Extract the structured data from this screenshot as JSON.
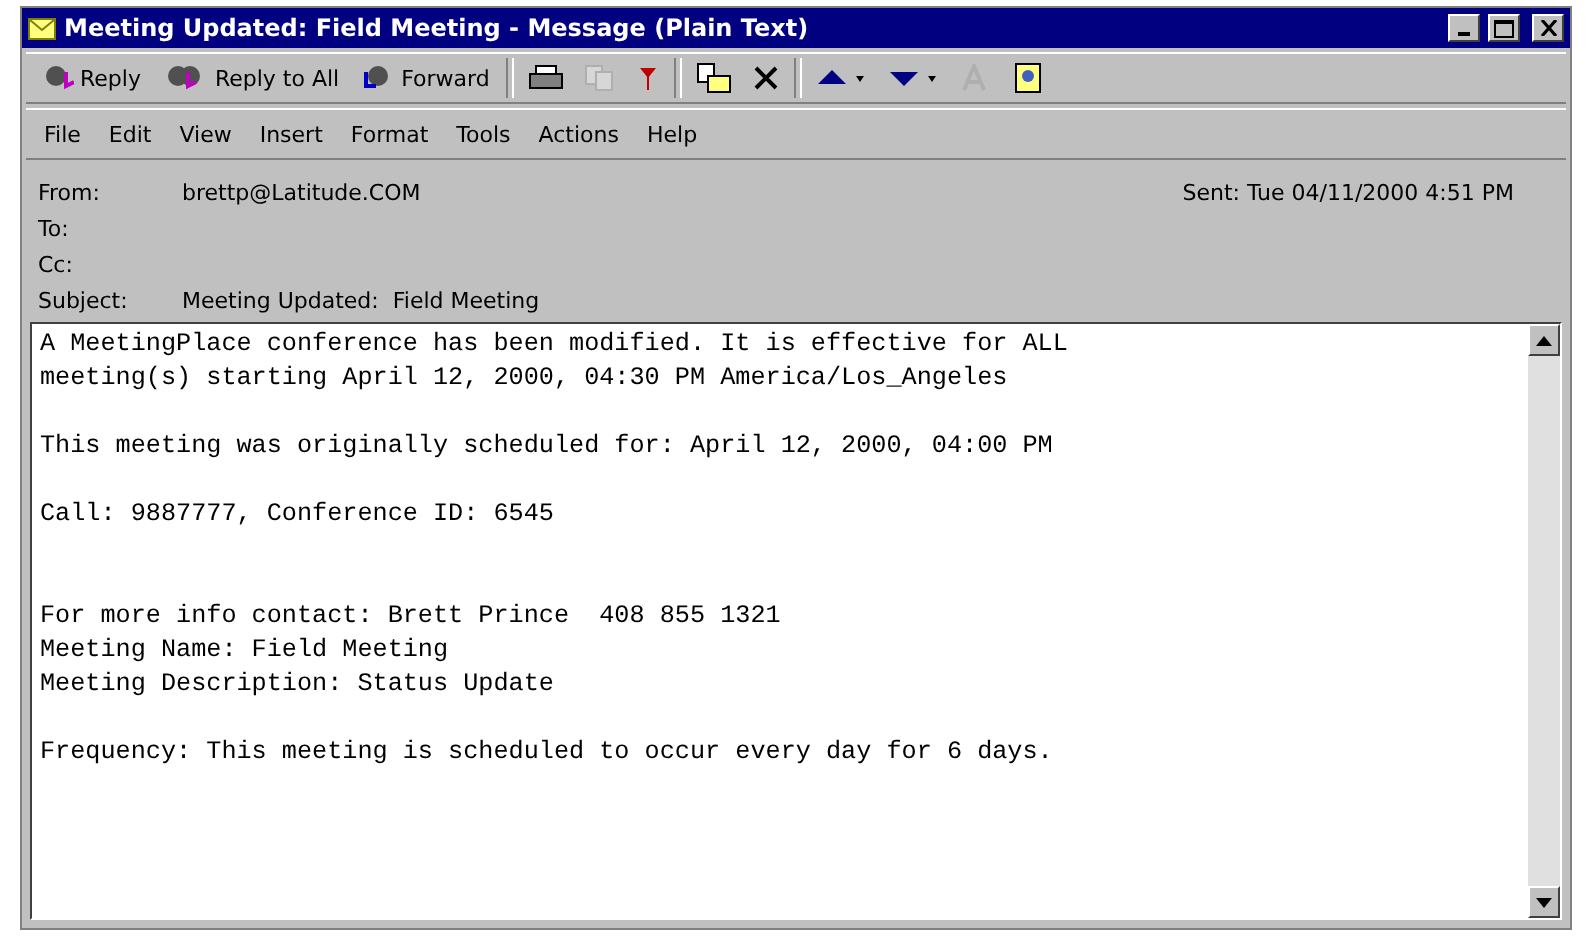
{
  "window": {
    "title": "Meeting Updated:  Field Meeting - Message (Plain Text)"
  },
  "toolbar": [
    {
      "kind": "text",
      "label": "Reply"
    },
    {
      "kind": "text",
      "label": "Reply to All"
    },
    {
      "kind": "text",
      "label": "Forward"
    },
    {
      "kind": "sep"
    },
    {
      "kind": "print",
      "disabled": false
    },
    {
      "kind": "copy",
      "disabled": true
    },
    {
      "kind": "flag",
      "disabled": false
    },
    {
      "kind": "sep"
    },
    {
      "kind": "move",
      "disabled": false
    },
    {
      "kind": "delete",
      "disabled": false
    },
    {
      "kind": "sep"
    },
    {
      "kind": "up",
      "disabled": false
    },
    {
      "kind": "down",
      "disabled": false
    },
    {
      "kind": "font",
      "disabled": true
    },
    {
      "kind": "book",
      "disabled": false
    }
  ],
  "menu": [
    "File",
    "Edit",
    "View",
    "Insert",
    "Format",
    "Tools",
    "Actions",
    "Help"
  ],
  "header": {
    "from_label": "From:",
    "from": "brettp@Latitude.COM",
    "sent_label": "Sent:",
    "sent": "Tue 04/11/2000 4:51 PM",
    "to_label": "To:",
    "cc_label": "Cc:",
    "subject_label": "Subject:",
    "subject": "Meeting Updated:  Field Meeting"
  },
  "body": [
    [
      "A MeetingPlace conference has been modified. It is effective for ALL",
      "meeting(s) starting April 12, 2000, 04:30 PM America/Los_Angeles"
    ],
    [
      "This meeting was originally scheduled for: April 12, 2000, 04:00 PM"
    ],
    [
      "Call: 9887777, Conference ID: 6545"
    ],
    [
      "For more info contact: Brett Prince  408 855 1321",
      "Meeting Name: Field Meeting",
      "Meeting Description: Status Update"
    ],
    [
      "Frequency: This meeting is scheduled to occur every day for 6 days."
    ]
  ]
}
